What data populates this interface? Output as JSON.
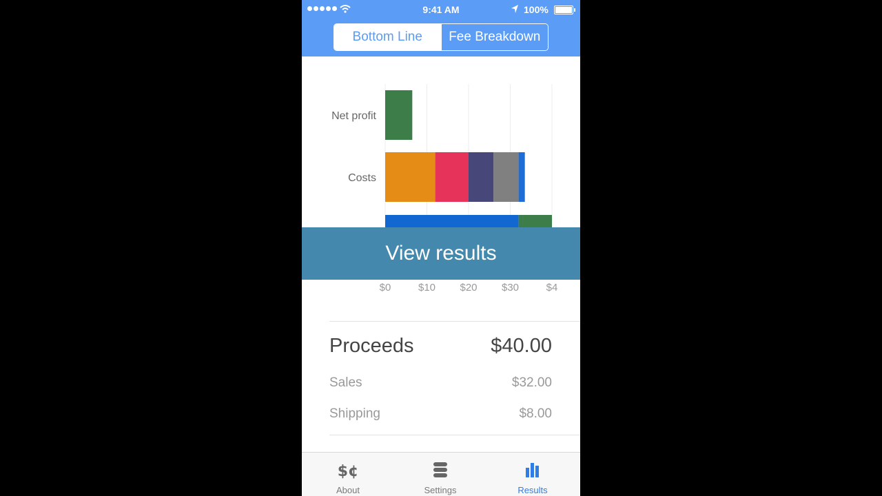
{
  "status_bar": {
    "time": "9:41 AM",
    "battery": "100%"
  },
  "segmented_control": {
    "options": [
      "Bottom Line",
      "Fee Breakdown"
    ],
    "selected": "Fee Breakdown"
  },
  "chart_data": {
    "type": "bar",
    "orientation": "horizontal",
    "stacked": true,
    "categories": [
      "Net profit",
      "Costs",
      ""
    ],
    "x_ticks": [
      "$0",
      "$10",
      "$20",
      "$30",
      "$4"
    ],
    "xlim": [
      0,
      40
    ],
    "segments": [
      {
        "category": "Net profit",
        "values": [
          6.5
        ],
        "colors": [
          "#3c7d4a"
        ]
      },
      {
        "category": "Costs",
        "values": [
          12,
          8,
          6,
          6,
          1.5
        ],
        "colors": [
          "#e48c16",
          "#e5335a",
          "#474879",
          "#808080",
          "#1e6cd6"
        ]
      },
      {
        "category": "",
        "values": [
          32,
          8
        ],
        "colors": [
          "#1367d1",
          "#3c7d4a"
        ]
      }
    ],
    "grid": true
  },
  "view_results_label": "View results",
  "summary": {
    "proceeds_label": "Proceeds",
    "proceeds_value": "$40.00",
    "items": [
      {
        "label": "Sales",
        "value": "$32.00"
      },
      {
        "label": "Shipping",
        "value": "$8.00"
      }
    ]
  },
  "tabs": [
    {
      "label": "About",
      "icon": "dollar-cent-icon",
      "active": false
    },
    {
      "label": "Settings",
      "icon": "stack-icon",
      "active": false
    },
    {
      "label": "Results",
      "icon": "bar-chart-icon",
      "active": true
    }
  ],
  "colors": {
    "header": "#5b9cf6",
    "view_results": "#4489ad",
    "active_tab": "#2f7ee8"
  }
}
